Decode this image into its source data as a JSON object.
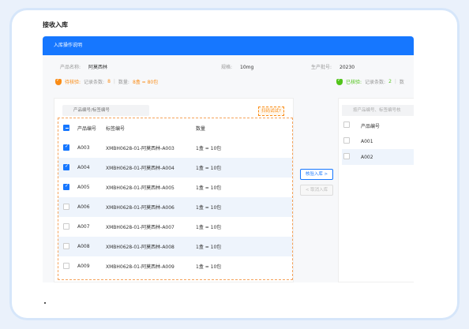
{
  "page_title": "接收入库",
  "panel": {
    "header": "入库操作说明",
    "product_name_label": "产品名称:",
    "product_name": "阿莫西林",
    "spec_label": "规格:",
    "spec": "10mg",
    "batch_label": "生产批号:",
    "batch": "20230"
  },
  "pending": {
    "title": "待核验:",
    "record_label": "记录条数:",
    "record_count": "8",
    "qty_label": "数量:",
    "qty": "8盒 = 80包",
    "search_placeholder": "产品编号/标签编号",
    "scan_label": "扫码试试?",
    "columns": [
      "产品编号",
      "标签编号",
      "数量"
    ],
    "rows": [
      {
        "product": "A003",
        "label": "XMBH0628-01-阿莫西林-A003",
        "qty": "1盒 = 10包",
        "checked": true
      },
      {
        "product": "A004",
        "label": "XMBH0628-01-阿莫西林-A004",
        "qty": "1盒 = 10包",
        "checked": true
      },
      {
        "product": "A005",
        "label": "XMBH0628-01-阿莫西林-A005",
        "qty": "1盒 = 10包",
        "checked": true
      },
      {
        "product": "A006",
        "label": "XMBH0628-01-阿莫西林-A006",
        "qty": "1盒 = 10包",
        "checked": false
      },
      {
        "product": "A007",
        "label": "XMBH0628-01-阿莫西林-A007",
        "qty": "1盒 = 10包",
        "checked": false
      },
      {
        "product": "A008",
        "label": "XMBH0628-01-阿莫西林-A008",
        "qty": "1盒 = 10包",
        "checked": false
      },
      {
        "product": "A009",
        "label": "XMBH0628-01-阿莫西林-A009",
        "qty": "1盒 = 10包",
        "checked": false
      }
    ]
  },
  "actions": {
    "confirm": "核验入库 >",
    "cancel": "< 取消入库"
  },
  "verified": {
    "title": "已核验:",
    "record_label": "记录条数:",
    "record_count": "2",
    "qty_label": "数",
    "search_placeholder": "按产品编号、标签编号核",
    "column": "产品编号",
    "rows": [
      "A001",
      "A002"
    ]
  },
  "colors": {
    "primary": "#1677ff",
    "pending": "#fa8c16",
    "verified": "#52c41a"
  }
}
